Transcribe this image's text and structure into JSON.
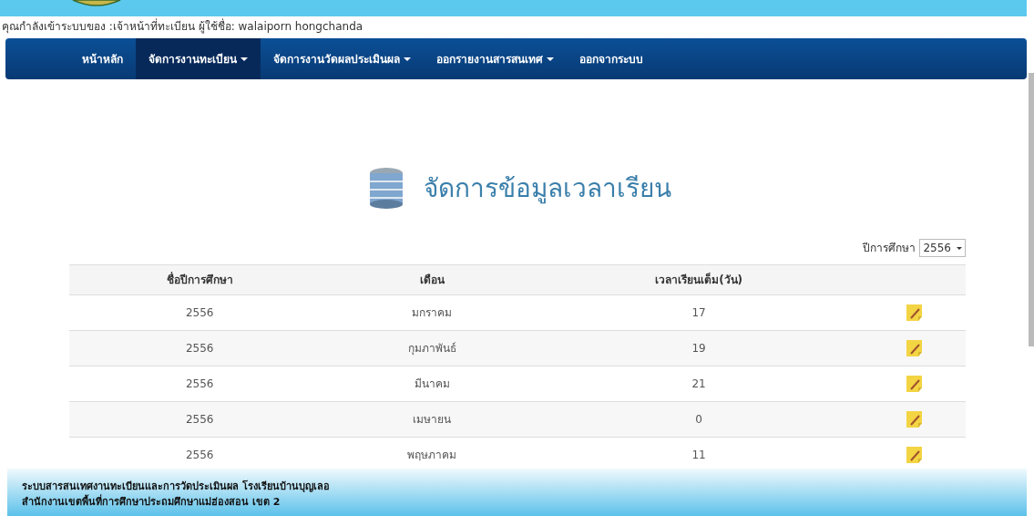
{
  "login_info": "คุณกำลังเข้าระบบของ :เจ้าหน้าที่ทะเบียน ผู้ใช้ชื่อ: walaiporn hongchanda",
  "nav": [
    {
      "label": "หน้าหลัก",
      "selected": false,
      "has_menu": false
    },
    {
      "label": "จัดการงานทะเบียน",
      "selected": true,
      "has_menu": true
    },
    {
      "label": "จัดการงานวัดผลประเมินผล",
      "selected": false,
      "has_menu": true
    },
    {
      "label": "ออกรายงานสารสนเทศ",
      "selected": false,
      "has_menu": true
    },
    {
      "label": "ออกจากระบบ",
      "selected": false,
      "has_menu": false
    }
  ],
  "page_title": "จัดการข้อมูลเวลาเรียน",
  "year_filter": {
    "label": "ปีการศึกษา",
    "value": "2556"
  },
  "table": {
    "columns": [
      "ชื่อปีการศึกษา",
      "เดือน",
      "เวลาเรียนเต็ม(วัน)"
    ],
    "rows": [
      [
        "2556",
        "มกราคม",
        "17"
      ],
      [
        "2556",
        "กุมภาพันธ์",
        "19"
      ],
      [
        "2556",
        "มีนาคม",
        "21"
      ],
      [
        "2556",
        "เมษายน",
        "0"
      ],
      [
        "2556",
        "พฤษภาคม",
        "11"
      ]
    ]
  },
  "footer": [
    "ระบบสารสนเทศงานทะเบียนและการวัดประเมินผล โรงเรียนบ้านบุญเลอ",
    "สำนักงานเขตพื้นที่การศึกษาประถมศึกษาแม่ฮ่องสอน เขต 2"
  ]
}
